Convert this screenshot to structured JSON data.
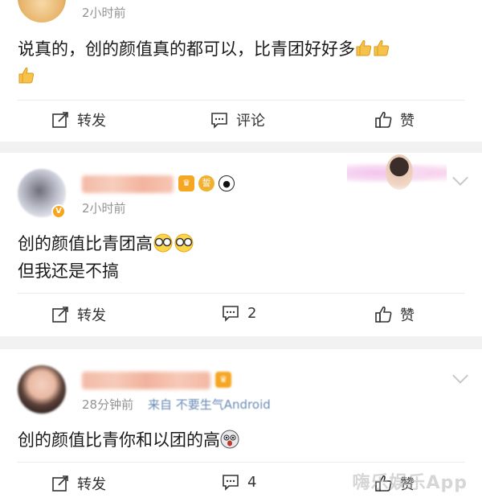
{
  "posts": [
    {
      "time": "2小时前",
      "content_lines": [
        "说真的，创的颜值真的都可以，比青团好好多"
      ],
      "actions": {
        "repost": "转发",
        "comment": "评论",
        "like": "赞"
      }
    },
    {
      "time": "2小时前",
      "content_lines": [
        "创的颜值比青团高",
        "但我还是不搞"
      ],
      "actions": {
        "repost": "转发",
        "comment": "2",
        "like": "赞"
      }
    },
    {
      "time": "28分钟前",
      "source": "来自 不要生气Android",
      "content_lines": [
        "创的颜值比青你和以团的高"
      ],
      "actions": {
        "repost": "转发",
        "comment": "4",
        "like": "赞"
      }
    }
  ],
  "watermark": "嗨乐娱乐App",
  "icons": [
    "repost-icon",
    "comment-icon",
    "like-icon",
    "thumbs-up-emoji",
    "verified-icon",
    "crown-badge-icon",
    "panda-icon",
    "sunglasses-emoji",
    "shocked-face-emoji",
    "chevron-down-icon"
  ],
  "colors": {
    "divider": "#f2f2f2",
    "time": "#939393",
    "verified": "#f7a51c"
  }
}
